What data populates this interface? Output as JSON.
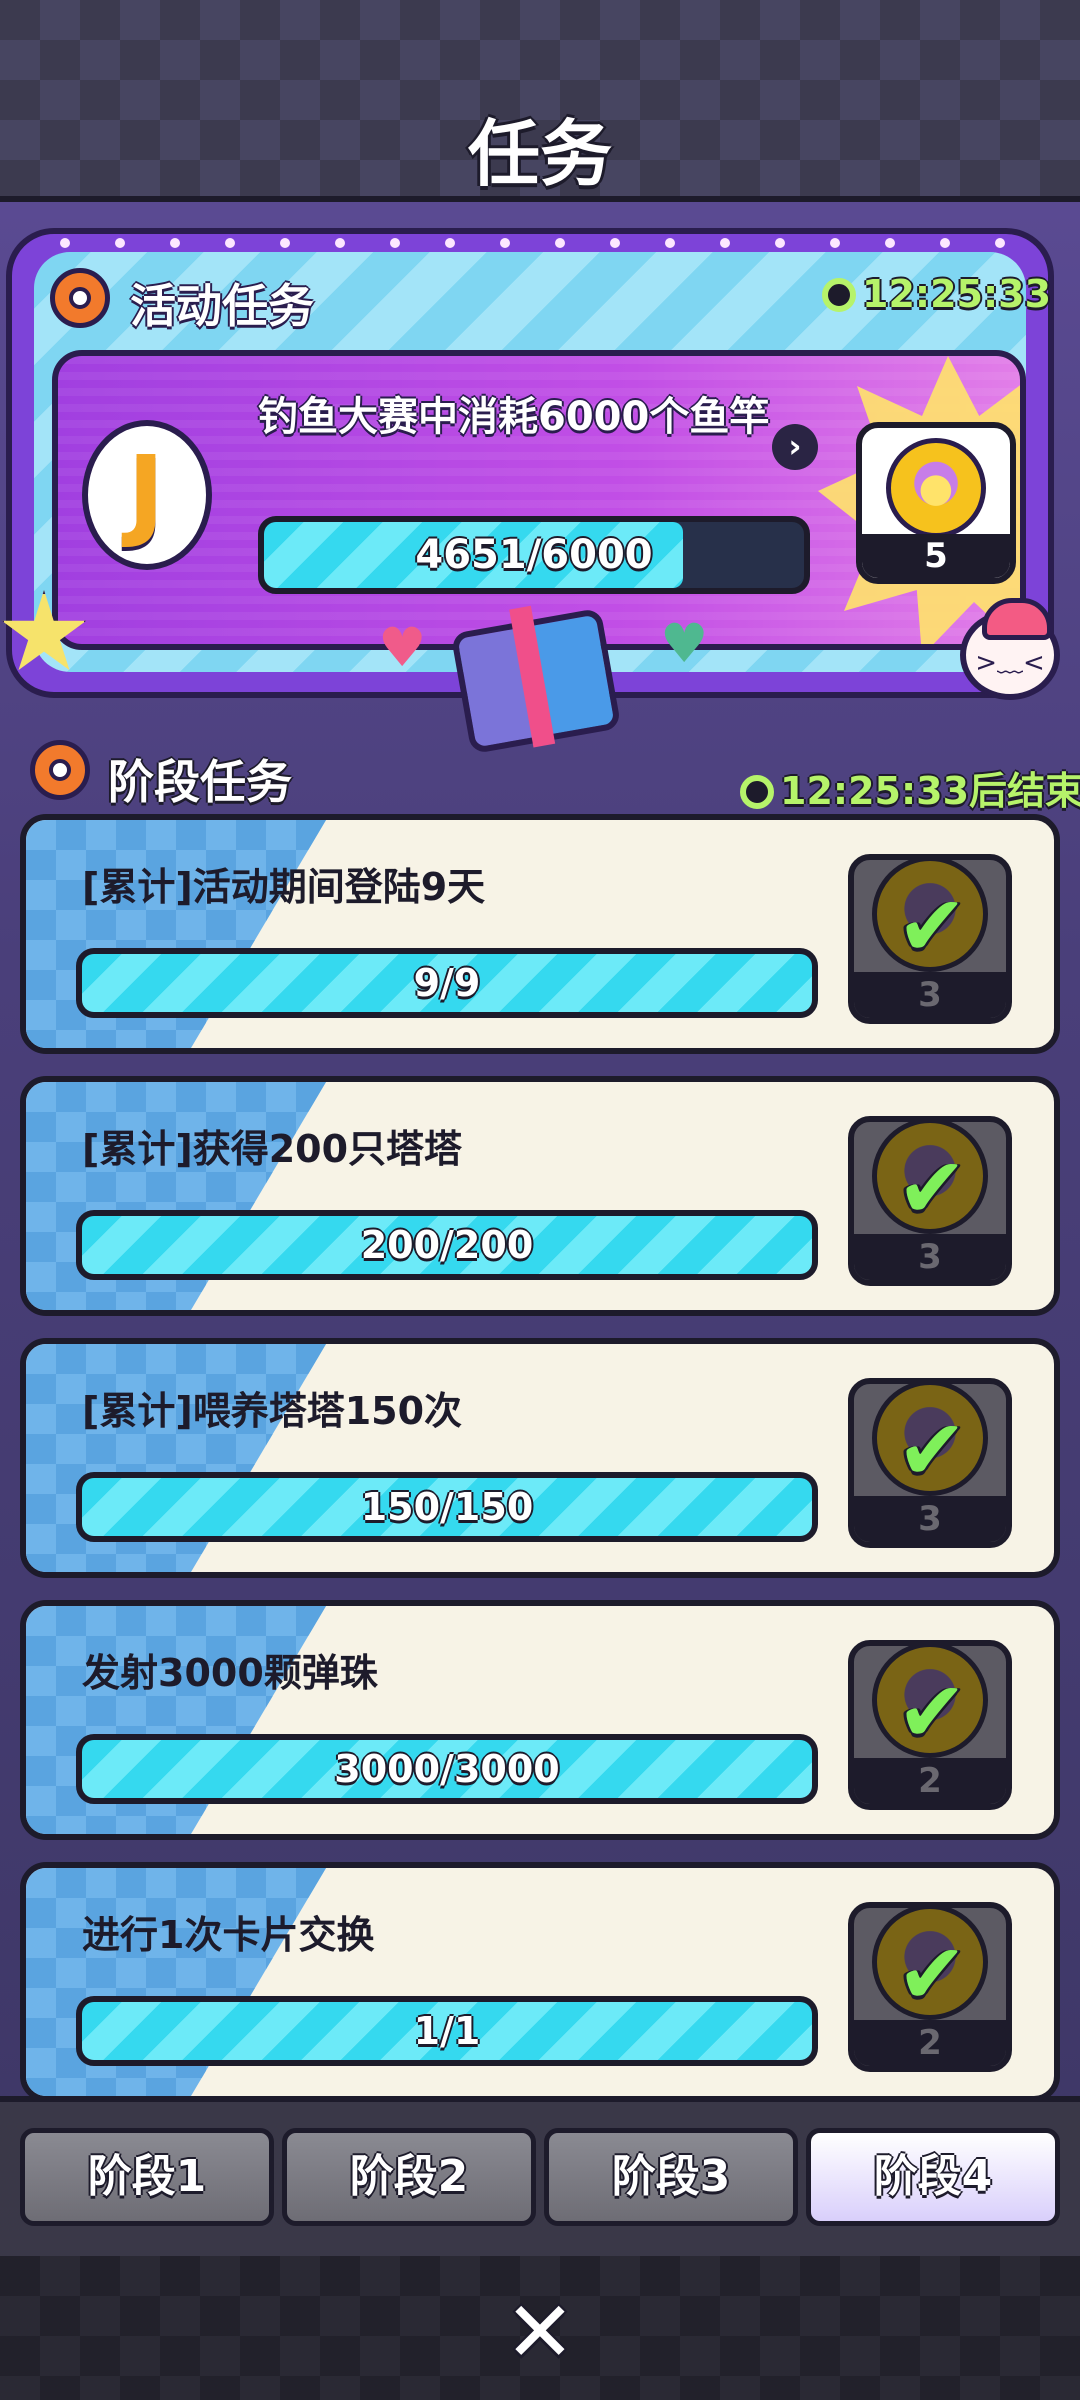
{
  "header": {
    "title": "任务"
  },
  "event": {
    "title": "活动任务",
    "timer": "12:25:33",
    "task_text": "钓鱼大赛中消耗6000个鱼竿",
    "progress_text": "4651/6000",
    "progress_fraction": 0.775,
    "reward_count": "5"
  },
  "stage": {
    "title": "阶段任务",
    "timer_text": "12:25:33后结束",
    "tasks": [
      {
        "label": "[累计]活动期间登陆9天",
        "progress_text": "9/9",
        "progress_fraction": 1.0,
        "reward_count": "3"
      },
      {
        "label": "[累计]获得200只塔塔",
        "progress_text": "200/200",
        "progress_fraction": 1.0,
        "reward_count": "3"
      },
      {
        "label": "[累计]喂养塔塔150次",
        "progress_text": "150/150",
        "progress_fraction": 1.0,
        "reward_count": "3"
      },
      {
        "label": "发射3000颗弹珠",
        "progress_text": "3000/3000",
        "progress_fraction": 1.0,
        "reward_count": "2"
      },
      {
        "label": "进行1次卡片交换",
        "progress_text": "1/1",
        "progress_fraction": 1.0,
        "reward_count": "2"
      }
    ]
  },
  "tabs": [
    {
      "label": "阶段1",
      "active": false
    },
    {
      "label": "阶段2",
      "active": false
    },
    {
      "label": "阶段3",
      "active": false
    },
    {
      "label": "阶段4",
      "active": true
    }
  ],
  "close_label": "✕",
  "colors": {
    "accent_cyan": "#35d9ef",
    "timer_green": "#b6f36a",
    "tab_active": "#d9cffb"
  },
  "icons": {
    "event": "target-icon",
    "timer": "stopwatch-icon",
    "hook": "fishing-hook-icon",
    "coin": "cat-coin-icon",
    "check": "checkmark-icon",
    "close": "close-icon",
    "goto": "chevron-right-icon"
  }
}
